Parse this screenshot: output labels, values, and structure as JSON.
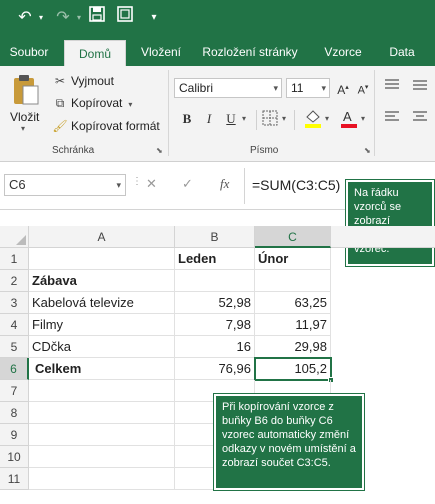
{
  "colors": {
    "brand": "#217346",
    "ribbon_bg": "#f3f3f3",
    "callout_bg": "#217346"
  },
  "qat": {
    "icons": [
      "undo-icon",
      "redo-icon",
      "save-icon",
      "screenshot-icon",
      "customize-icon"
    ]
  },
  "tabs": [
    {
      "label": "Soubor",
      "active": false
    },
    {
      "label": "Domů",
      "active": true
    },
    {
      "label": "Vložení",
      "active": false
    },
    {
      "label": "Rozložení stránky",
      "active": false
    },
    {
      "label": "Vzorce",
      "active": false
    },
    {
      "label": "Data",
      "active": false
    }
  ],
  "clipboard": {
    "paste_label": "Vložit",
    "cut_label": "Vyjmout",
    "copy_label": "Kopírovat",
    "format_painter_label": "Kopírovat formát",
    "group_label": "Schránka"
  },
  "font": {
    "font_name": "Calibri",
    "font_size": "11",
    "bold": "B",
    "italic": "I",
    "underline": "U",
    "group_label": "Písmo"
  },
  "formula_bar": {
    "name_box": "C6",
    "cancel_icon": "✕",
    "enter_icon": "✓",
    "fx_label": "fx",
    "formula": "=SUM(C3:C5)"
  },
  "callouts": {
    "formula": "Na řádku vzorců se zobrazí aktualizovaný vzorec.",
    "copy": "Při kopírování vzorce z buňky B6 do buňky C6 vzorec automaticky změní odkazy v novém umístění a zobrazí součet C3:C5."
  },
  "sheet": {
    "columns": [
      "A",
      "B",
      "C"
    ],
    "row_numbers": [
      "1",
      "2",
      "3",
      "4",
      "5",
      "6",
      "7",
      "8",
      "9",
      "10",
      "11"
    ],
    "selected_cell": "C6",
    "rows": [
      {
        "a": "",
        "b": "Leden",
        "c": "Únor"
      },
      {
        "a": "Zábava",
        "b": "",
        "c": ""
      },
      {
        "a": "Kabelová televize",
        "b": "52,98",
        "c": "63,25"
      },
      {
        "a": "Filmy",
        "b": "7,98",
        "c": "11,97"
      },
      {
        "a": "CDčka",
        "b": "16",
        "c": "29,98"
      },
      {
        "a": "Celkem",
        "b": "76,96",
        "c": "105,2"
      }
    ]
  }
}
